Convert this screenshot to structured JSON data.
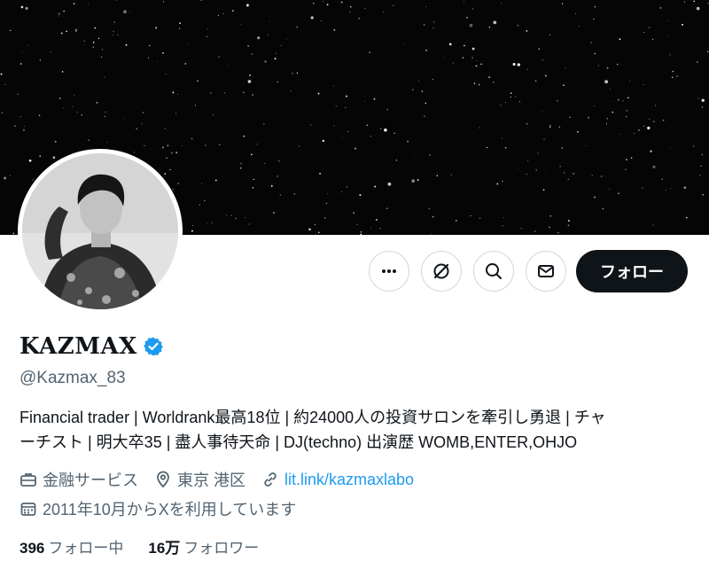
{
  "profile": {
    "name": "KAZMAX",
    "handle": "@Kazmax_83",
    "bio_line1": "Financial trader | Worldrank最高18位 | 約24000人の投資サロンを牽引し勇退 | チャ",
    "bio_line2": "ーチスト | 明大卒35 | 盡人事待天命 | DJ(techno) 出演歴 WOMB,ENTER,OHJO",
    "category": "金融サービス",
    "location": "東京 港区",
    "website": "lit.link/kazmaxlabo",
    "joined": "2011年10月からXを利用しています",
    "verified_color": "#1d9bf0"
  },
  "actions": {
    "more_icon": "more-icon",
    "grok_icon": "grok-icon",
    "search_icon": "search-icon",
    "message_icon": "mail-icon",
    "follow_label": "フォロー"
  },
  "stats": {
    "following_count": "396",
    "following_label": "フォロー中",
    "followers_count": "16万",
    "followers_label": "フォロワー"
  }
}
